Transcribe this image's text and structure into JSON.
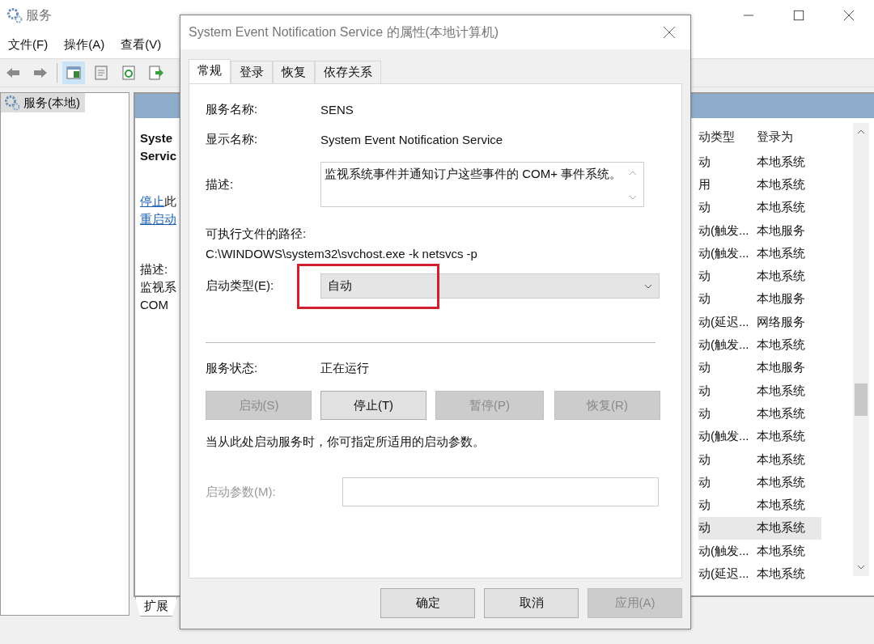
{
  "window": {
    "title": "服务"
  },
  "menu": [
    "文件(F)",
    "操作(A)",
    "查看(V)"
  ],
  "toolbar": [
    {
      "kind": "back",
      "selected": false
    },
    {
      "kind": "forward",
      "selected": false
    },
    {
      "kind": "pane",
      "selected": true
    },
    {
      "kind": "sheet",
      "selected": false
    },
    {
      "kind": "refresh",
      "selected": false
    },
    {
      "kind": "export",
      "selected": false
    }
  ],
  "tree": {
    "items": [
      {
        "label": "服务(本地)",
        "selected": true
      }
    ]
  },
  "detail": {
    "title_lines": [
      "Syste",
      "Servic"
    ],
    "actions": [
      {
        "link": "停止",
        "text": "此"
      },
      {
        "link": "重启动"
      }
    ],
    "description_label": "描述:",
    "description_lines": [
      "监视系",
      "COM"
    ]
  },
  "services_table": {
    "columns": [
      "动类型",
      "登录为"
    ],
    "rows": [
      {
        "startup_type": "动",
        "log_on_as": "本地系统",
        "selected": false
      },
      {
        "startup_type": "用",
        "log_on_as": "本地系统",
        "selected": false
      },
      {
        "startup_type": "动",
        "log_on_as": "本地系统",
        "selected": false
      },
      {
        "startup_type": "动(触发...",
        "log_on_as": "本地服务",
        "selected": false
      },
      {
        "startup_type": "动(触发...",
        "log_on_as": "本地系统",
        "selected": false
      },
      {
        "startup_type": "动",
        "log_on_as": "本地系统",
        "selected": false
      },
      {
        "startup_type": "动",
        "log_on_as": "本地服务",
        "selected": false
      },
      {
        "startup_type": "动(延迟...",
        "log_on_as": "网络服务",
        "selected": false
      },
      {
        "startup_type": "动(触发...",
        "log_on_as": "本地系统",
        "selected": false
      },
      {
        "startup_type": "动",
        "log_on_as": "本地服务",
        "selected": false
      },
      {
        "startup_type": "动",
        "log_on_as": "本地系统",
        "selected": false
      },
      {
        "startup_type": "动",
        "log_on_as": "本地系统",
        "selected": false
      },
      {
        "startup_type": "动(触发...",
        "log_on_as": "本地系统",
        "selected": false
      },
      {
        "startup_type": "动",
        "log_on_as": "本地系统",
        "selected": false
      },
      {
        "startup_type": "动",
        "log_on_as": "本地系统",
        "selected": false
      },
      {
        "startup_type": "动",
        "log_on_as": "本地系统",
        "selected": false
      },
      {
        "startup_type": "动",
        "log_on_as": "本地系统",
        "selected": true
      },
      {
        "startup_type": "动(触发...",
        "log_on_as": "本地系统",
        "selected": false
      },
      {
        "startup_type": "动(延迟...",
        "log_on_as": "本地系统",
        "selected": false
      }
    ]
  },
  "bottom_tabs": [
    {
      "label": "扩展",
      "selected": true
    }
  ],
  "dialog": {
    "title": "System Event Notification Service 的属性(本地计算机)",
    "tabs": [
      {
        "label": "常规",
        "selected": true
      },
      {
        "label": "登录",
        "selected": false
      },
      {
        "label": "恢复",
        "selected": false
      },
      {
        "label": "依存关系",
        "selected": false
      }
    ],
    "service_name": {
      "label": "服务名称:",
      "value": "SENS"
    },
    "display_name": {
      "label": "显示名称:",
      "value": "System Event Notification Service"
    },
    "description": {
      "label": "描述:",
      "value": "监视系统事件并通知订户这些事件的 COM+ 事件系统。"
    },
    "path": {
      "label": "可执行文件的路径:",
      "value": "C:\\WINDOWS\\system32\\svchost.exe -k netsvcs -p"
    },
    "startup_type": {
      "label": "启动类型(E):",
      "value": "自动",
      "highlighted": true
    },
    "service_status": {
      "label": "服务状态:",
      "value": "正在运行"
    },
    "service_buttons": [
      {
        "label": "启动(S)",
        "disabled": true
      },
      {
        "label": "停止(T)",
        "disabled": false
      },
      {
        "label": "暂停(P)",
        "disabled": true
      },
      {
        "label": "恢复(R)",
        "disabled": true
      }
    ],
    "hint": "当从此处启动服务时，你可指定所适用的启动参数。",
    "start_params": {
      "label": "启动参数(M):",
      "disabled": true
    },
    "buttons": [
      {
        "label": "确定",
        "disabled": false
      },
      {
        "label": "取消",
        "disabled": false
      },
      {
        "label": "应用(A)",
        "disabled": true
      }
    ]
  }
}
